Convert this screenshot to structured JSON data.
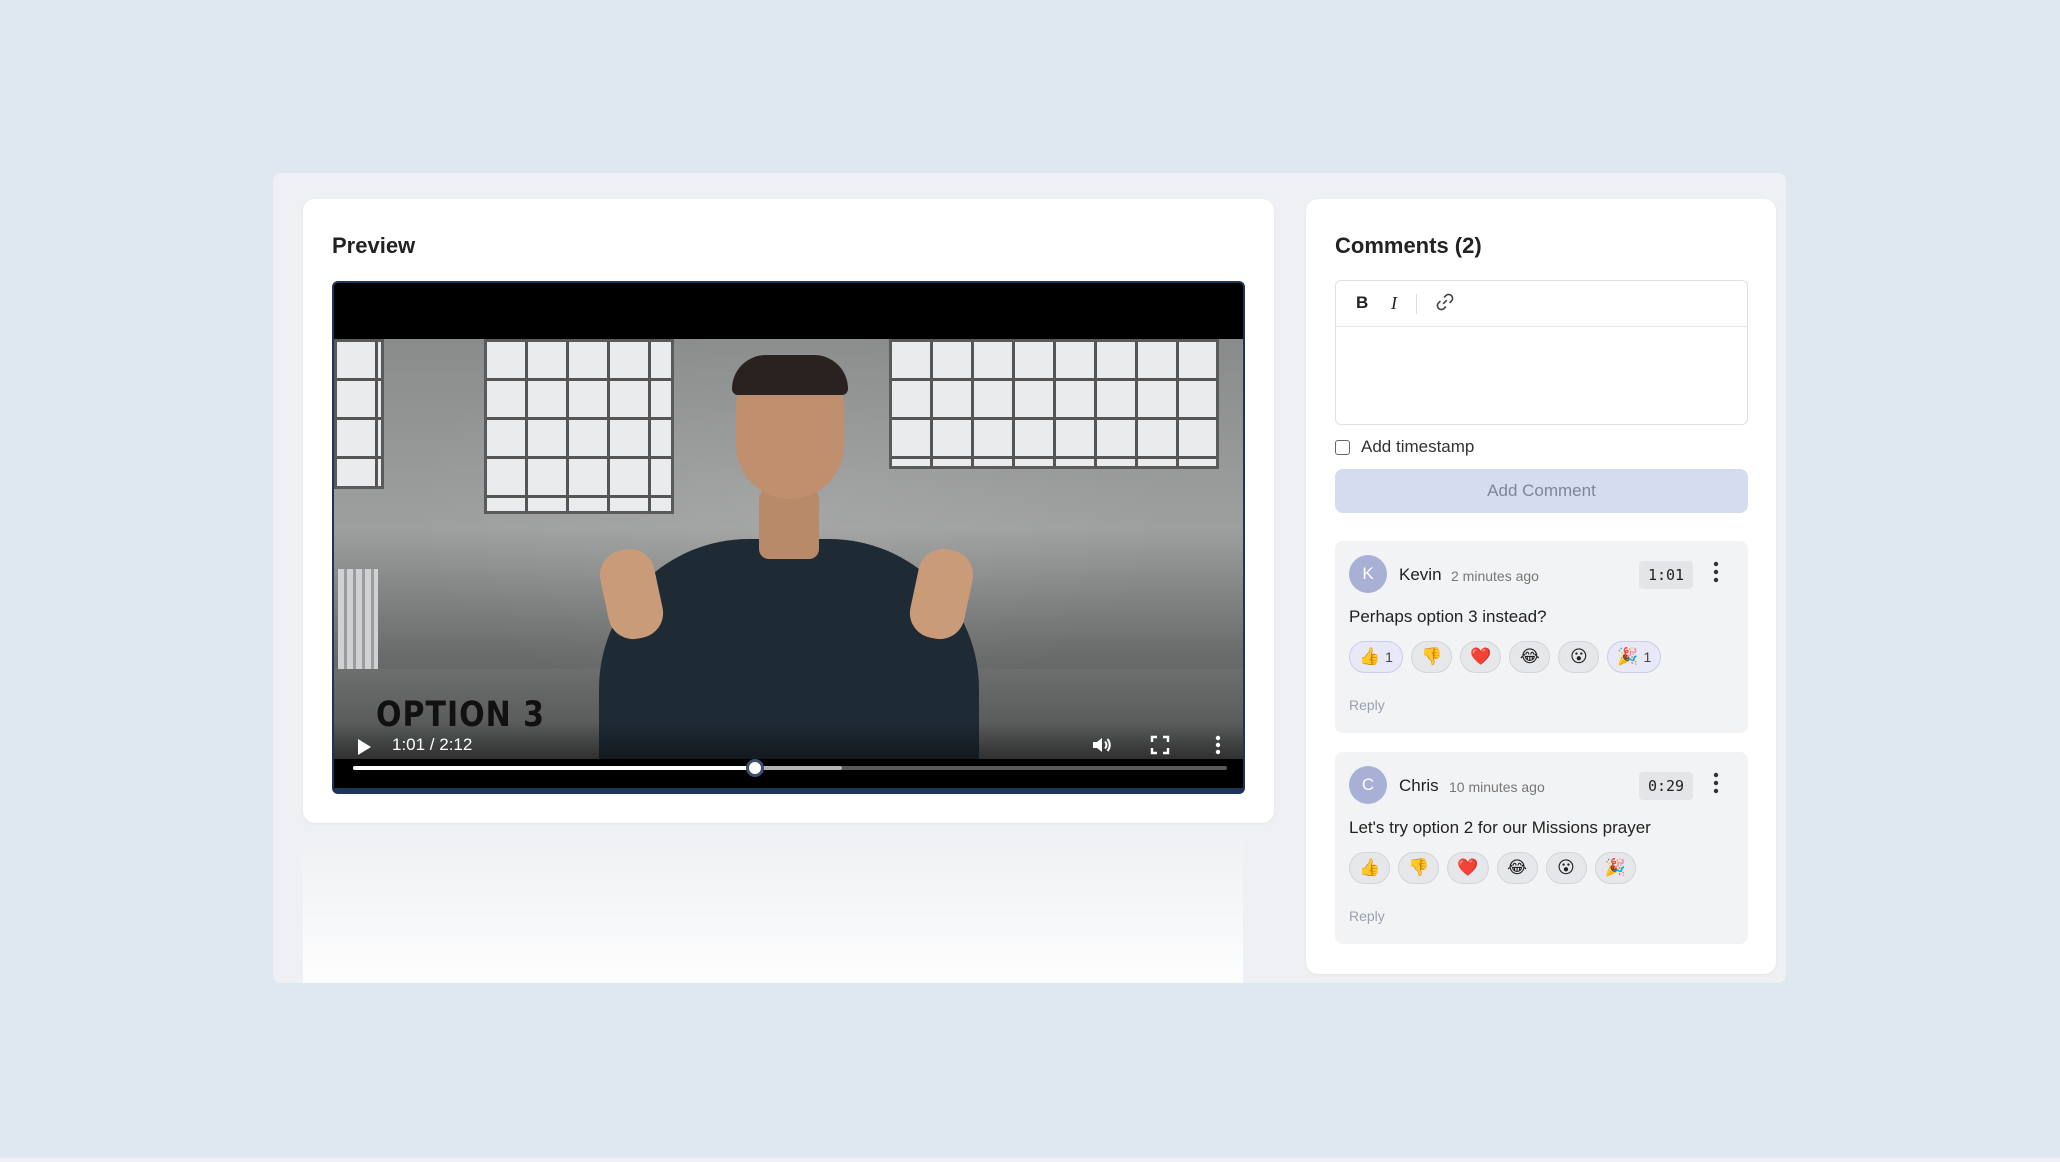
{
  "preview": {
    "title": "Preview",
    "video": {
      "caption": "OPTION 3",
      "time": "1:01 / 2:12",
      "progress_fraction": 0.46,
      "buffered_fraction": 0.56
    }
  },
  "comments": {
    "title": "Comments (2)",
    "editor": {
      "bold_label": "B",
      "italic_label": "I"
    },
    "timestamp_label": "Add timestamp",
    "add_button_label": "Add Comment",
    "items": [
      {
        "initial": "K",
        "author": "Kevin",
        "ago": "2 minutes ago",
        "timestamp": "1:01",
        "text": "Perhaps option 3 instead?",
        "reactions": [
          {
            "emoji": "👍",
            "count": "1",
            "active": true
          },
          {
            "emoji": "👎",
            "count": "",
            "active": false
          },
          {
            "emoji": "❤️",
            "count": "",
            "active": false
          },
          {
            "emoji": "😂",
            "count": "",
            "active": false
          },
          {
            "emoji": "😮",
            "count": "",
            "active": false
          },
          {
            "emoji": "🎉",
            "count": "1",
            "active": true
          }
        ],
        "reply_label": "Reply"
      },
      {
        "initial": "C",
        "author": "Chris",
        "ago": "10 minutes ago",
        "timestamp": "0:29",
        "text": "Let's try option 2 for our Missions prayer",
        "reactions": [
          {
            "emoji": "👍",
            "count": "",
            "active": false
          },
          {
            "emoji": "👎",
            "count": "",
            "active": false
          },
          {
            "emoji": "❤️",
            "count": "",
            "active": false
          },
          {
            "emoji": "😂",
            "count": "",
            "active": false
          },
          {
            "emoji": "😮",
            "count": "",
            "active": false
          },
          {
            "emoji": "🎉",
            "count": "",
            "active": false
          }
        ],
        "reply_label": "Reply"
      }
    ]
  },
  "colors": {
    "page_bg": "#dfe8f1",
    "accent": "#1e3557",
    "button_disabled": "#d5dcef",
    "avatar": "#a8b0d6"
  }
}
